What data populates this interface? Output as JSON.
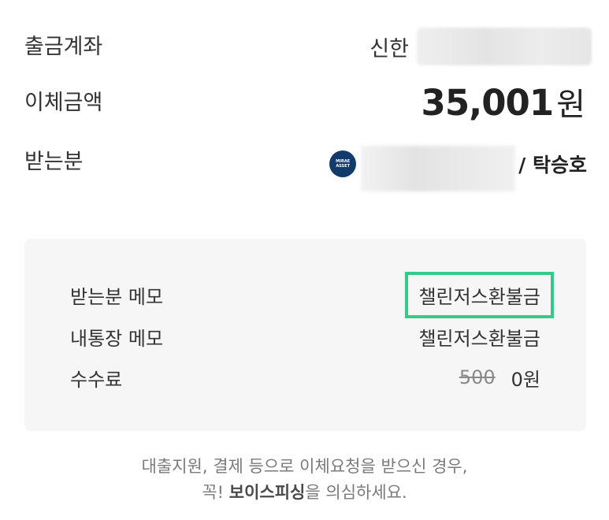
{
  "transfer": {
    "account_label": "출금계좌",
    "account_bank": "신한",
    "amount_label": "이체금액",
    "amount_value": "35,001",
    "amount_unit": "원",
    "recipient_label": "받는분",
    "recipient_name": "/ 탁승호"
  },
  "bank_logo": {
    "text": "MIRAE ASSET"
  },
  "memo": {
    "recipient_memo_label": "받는분 메모",
    "recipient_memo_value": "챌린저스환불금",
    "my_memo_label": "내통장 메모",
    "my_memo_value": "챌린저스환불금",
    "fee_label": "수수료",
    "fee_original": "500",
    "fee_value": "0원"
  },
  "notice": {
    "line1": "대출지원, 결제 등으로 이체요청을 받으신 경우,",
    "line2_prefix": "꼭! ",
    "line2_bold": "보이스피싱",
    "line2_suffix": "을 의심하세요."
  },
  "colors": {
    "highlight": "#35c98a",
    "card_background": "#f6f6f6",
    "bank_logo": "#123a6b"
  }
}
